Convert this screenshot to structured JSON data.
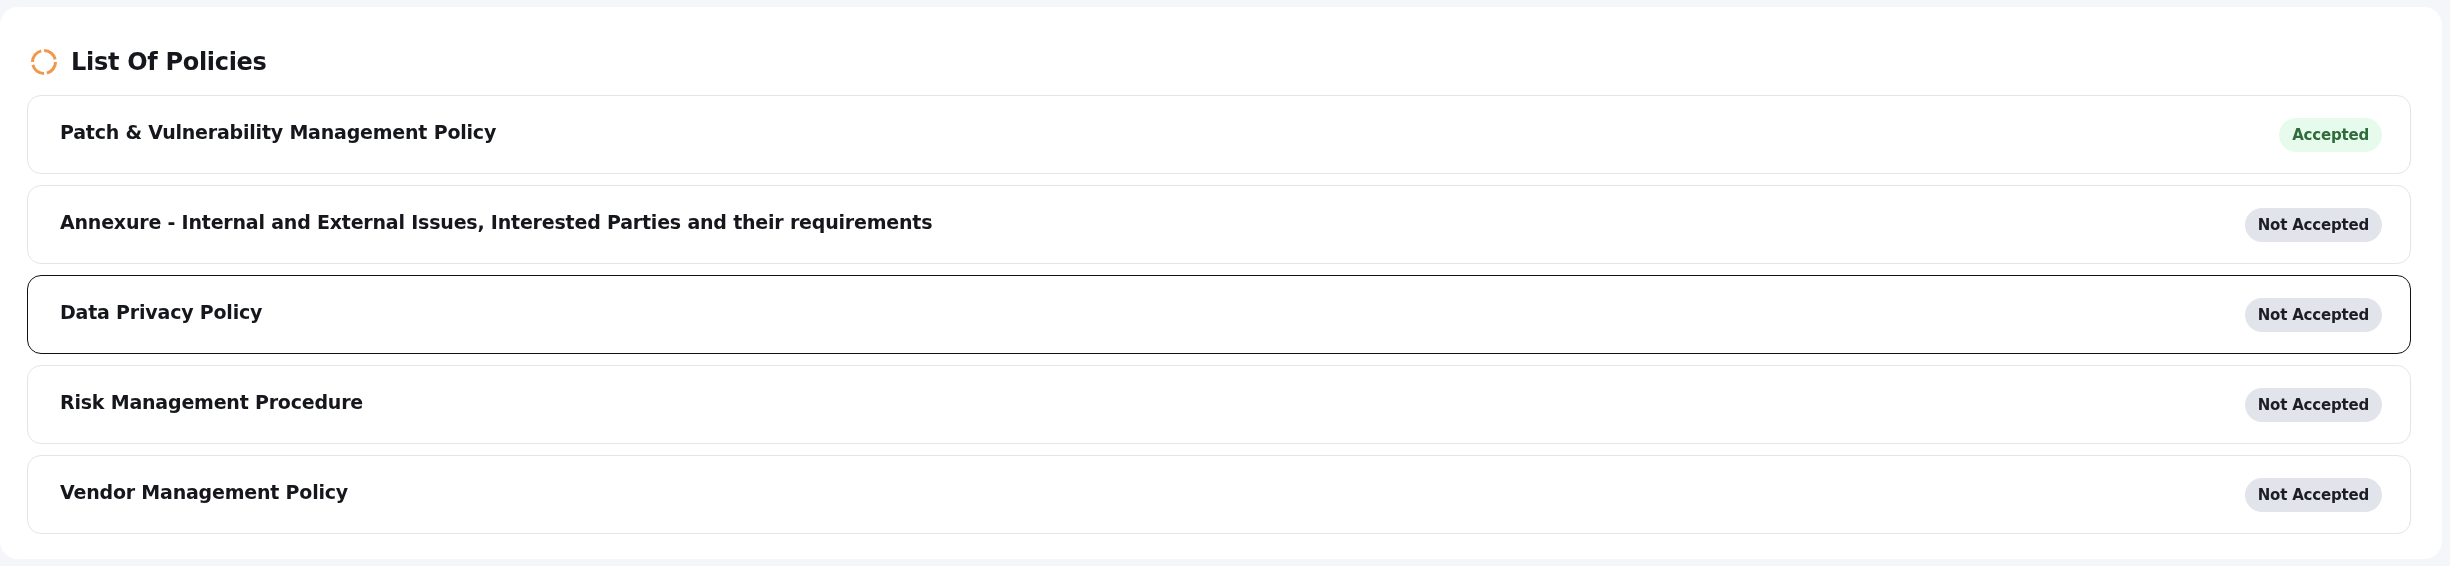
{
  "title": "List Of Policies",
  "policies": [
    {
      "name": "Patch & Vulnerability Management Policy",
      "status": "Accepted",
      "accepted": true,
      "selected": false
    },
    {
      "name": "Annexure - Internal and External Issues, Interested Parties and their requirements",
      "status": "Not Accepted",
      "accepted": false,
      "selected": false
    },
    {
      "name": "Data Privacy Policy",
      "status": "Not Accepted",
      "accepted": false,
      "selected": true
    },
    {
      "name": "Risk Management Procedure",
      "status": "Not Accepted",
      "accepted": false,
      "selected": false
    },
    {
      "name": "Vendor Management Policy",
      "status": "Not Accepted",
      "accepted": false,
      "selected": false
    }
  ]
}
